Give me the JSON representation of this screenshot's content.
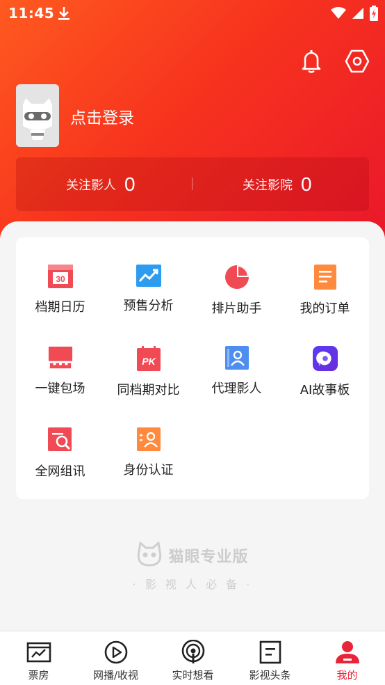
{
  "status": {
    "time": "11:45"
  },
  "profile": {
    "login_text": "点击登录"
  },
  "follow": [
    {
      "label": "关注影人",
      "count": "0"
    },
    {
      "label": "关注影院",
      "count": "0"
    }
  ],
  "tools": [
    {
      "label": "档期日历",
      "icon": "calendar-icon",
      "icon_text": "30"
    },
    {
      "label": "预售分析",
      "icon": "trend-chart-icon"
    },
    {
      "label": "排片助手",
      "icon": "pie-chart-icon"
    },
    {
      "label": "我的订单",
      "icon": "order-list-icon"
    },
    {
      "label": "一键包场",
      "icon": "screen-booking-icon"
    },
    {
      "label": "同档期对比",
      "icon": "pk-compare-icon",
      "icon_text": "PK"
    },
    {
      "label": "代理影人",
      "icon": "agent-person-icon"
    },
    {
      "label": "AI故事板",
      "icon": "ai-chat-icon"
    },
    {
      "label": "全网组讯",
      "icon": "search-doc-icon"
    },
    {
      "label": "身份认证",
      "icon": "identity-icon"
    }
  ],
  "brand": {
    "name": "猫眼专业版",
    "slogan": "· 影 视 人 必 备 ·"
  },
  "tabs": [
    {
      "label": "票房",
      "icon": "box-office-icon",
      "active": false
    },
    {
      "label": "网播/收视",
      "icon": "play-icon",
      "active": false
    },
    {
      "label": "实时想看",
      "icon": "broadcast-icon",
      "active": false
    },
    {
      "label": "影视头条",
      "icon": "news-icon",
      "active": false
    },
    {
      "label": "我的",
      "icon": "profile-icon",
      "active": true
    }
  ],
  "colors": {
    "accent": "#e8243a",
    "header_start": "#ff5a1f",
    "header_end": "#e9172a"
  }
}
